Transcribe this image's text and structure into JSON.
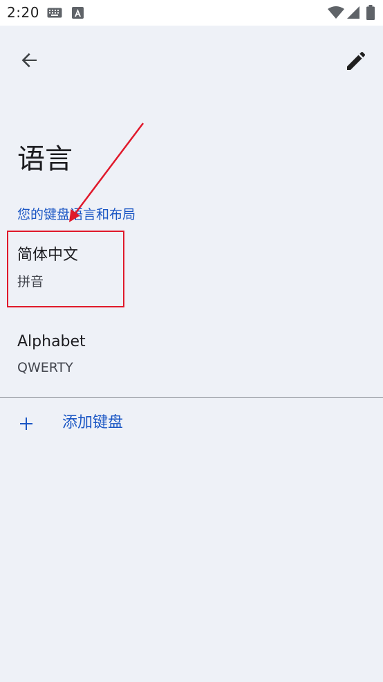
{
  "status_bar": {
    "time": "2:20",
    "icons": [
      "keyboard-icon",
      "text-a-icon",
      "wifi-icon",
      "signal-icon",
      "battery-icon"
    ]
  },
  "toolbar": {
    "back_icon": "arrow-left-icon",
    "edit_icon": "pencil-icon"
  },
  "page": {
    "title": "语言",
    "section_header": "您的键盘语言和布局"
  },
  "keyboards": [
    {
      "title": "简体中文",
      "layout": "拼音"
    },
    {
      "title": "Alphabet",
      "layout": "QWERTY"
    }
  ],
  "add_keyboard": {
    "label": "添加键盘",
    "icon": "plus-icon"
  },
  "colors": {
    "accent": "#1a56c4",
    "background": "#eef1f7",
    "annotation": "#e0192b"
  }
}
